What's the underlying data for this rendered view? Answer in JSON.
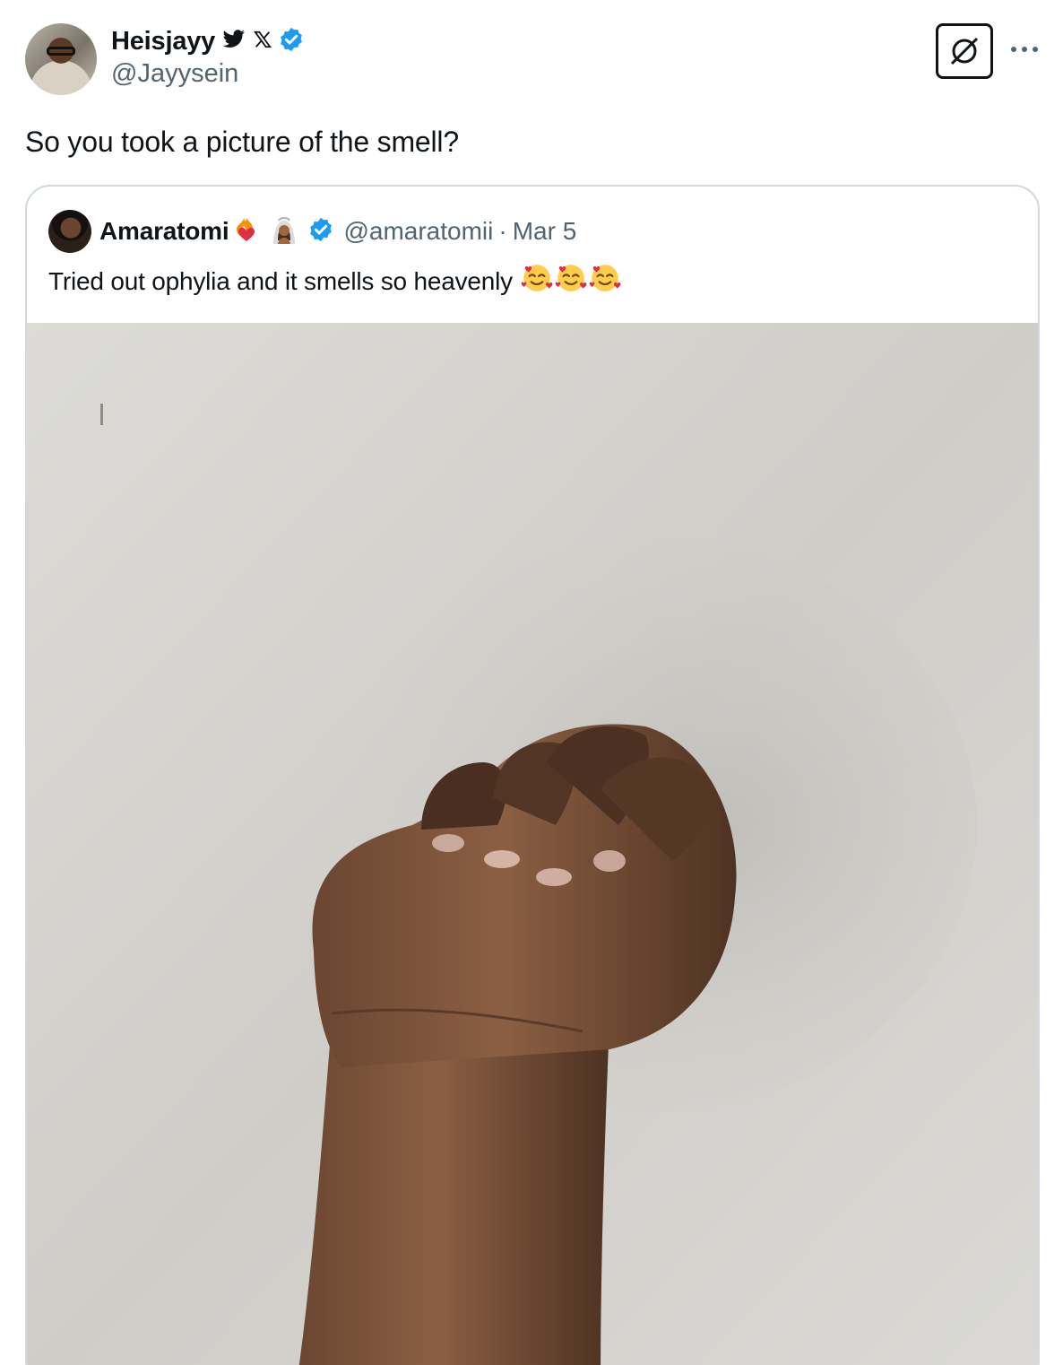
{
  "tweet": {
    "author": {
      "display_name": "Heisjayy",
      "handle": "@Jayysein"
    },
    "text": "So you took a picture of the smell?",
    "quoted": {
      "display_name": "Amaratomi",
      "handle": "@amaratomii",
      "separator": "·",
      "date": "Mar 5",
      "text": "Tried out ophylia and it smells so heavenly"
    }
  },
  "icons": {
    "bird": "bird-icon",
    "x": "x-logo-icon",
    "verified": "verified-badge-icon",
    "grok": "grok-icon",
    "more": "more-dots-icon",
    "heart_on_fire": "heart-on-fire-emoji",
    "woman_veil": "woman-with-veil-emoji",
    "smiling_hearts": "smiling-face-with-hearts-emoji"
  },
  "colors": {
    "verified": "#1d9bf0",
    "text": "#0f1419",
    "secondary": "#536471",
    "border": "#cfd9de"
  }
}
